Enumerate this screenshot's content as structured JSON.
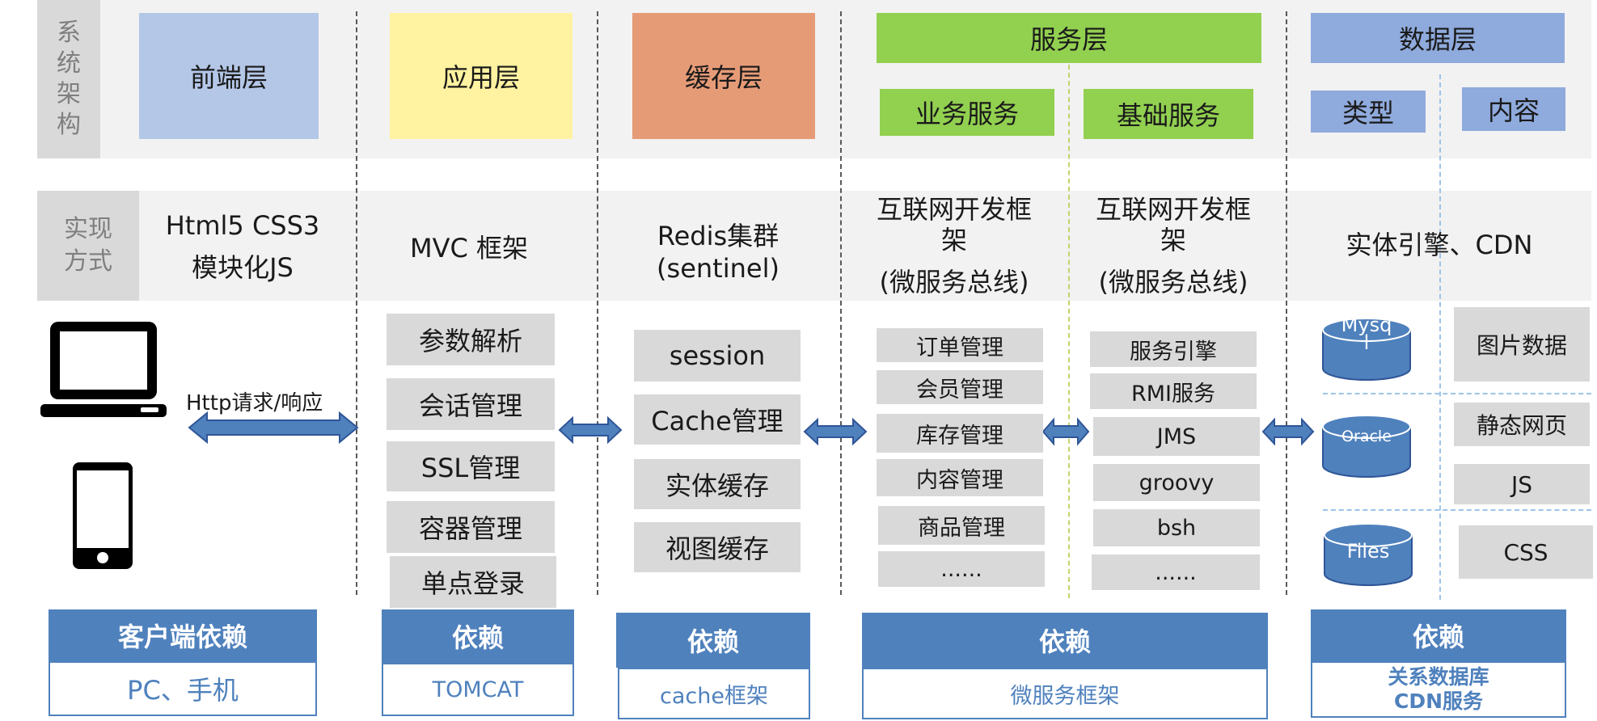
{
  "row_labels": {
    "arch": [
      "系",
      "统",
      "架",
      "构"
    ],
    "impl": [
      "实现",
      "方式"
    ]
  },
  "layers": {
    "frontend": "前端层",
    "application": "应用层",
    "cache": "缓存层",
    "service": "服务层",
    "service_business": "业务服务",
    "service_base": "基础服务",
    "data": "数据层",
    "data_type": "类型",
    "data_content": "内容"
  },
  "impl": {
    "frontend": [
      "Html5 CSS3",
      "模块化JS"
    ],
    "application": "MVC 框架",
    "cache": [
      "Redis集群",
      "(sentinel)"
    ],
    "business": [
      "互联网开发框",
      "架",
      "(微服务总线)"
    ],
    "base": [
      "互联网开发框",
      "架",
      "(微服务总线)"
    ],
    "data": "实体引擎、CDN"
  },
  "client": {
    "arrow_label": "Http请求/响应",
    "icons": [
      "monitor-icon",
      "phone-icon"
    ]
  },
  "app_items": [
    "参数解析",
    "会话管理",
    "SSL管理",
    "容器管理",
    "单点登录"
  ],
  "cache_items": [
    "session",
    "Cache管理",
    "实体缓存",
    "视图缓存"
  ],
  "business_items": [
    "订单管理",
    "会员管理",
    "库存管理",
    "内容管理",
    "商品管理",
    "......"
  ],
  "base_items": [
    "服务引擎",
    "RMI服务",
    "JMS",
    "groovy",
    "bsh",
    "......"
  ],
  "db_types": [
    "Mysq\nl",
    "Oracle",
    "Files"
  ],
  "data_contents": [
    "图片数据",
    "静态网页",
    "JS",
    "CSS"
  ],
  "footers": [
    {
      "top": "客户端依赖",
      "bottom": "PC、手机"
    },
    {
      "top": "依赖",
      "bottom": "TOMCAT"
    },
    {
      "top": "依赖",
      "bottom": "cache框架"
    },
    {
      "top": "依赖",
      "bottom": "微服务框架"
    },
    {
      "top": "依赖",
      "bottom": "关系数据库\nCDN服务"
    }
  ],
  "colors": {
    "frontend": "#b4c7e7",
    "application": "#fff2a0",
    "cache": "#e69b77",
    "service": "#92d050",
    "data": "#8faadc",
    "footer_blue": "#4f81bd",
    "db_cylinder": "#4f81bd"
  }
}
